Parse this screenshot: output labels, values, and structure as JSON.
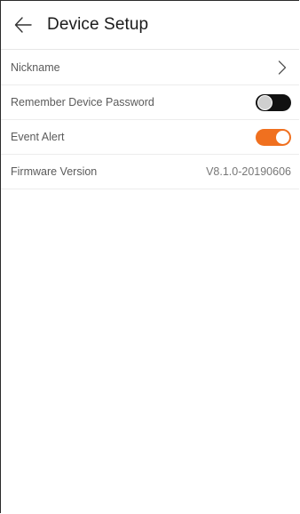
{
  "header": {
    "title": "Device Setup",
    "back_icon": "arrow-left-icon"
  },
  "rows": [
    {
      "label": "Nickname",
      "control": "chevron",
      "icon": "chevron-right-icon"
    },
    {
      "label": "Remember Device Password",
      "control": "toggle",
      "checked": false
    },
    {
      "label": "Event Alert",
      "control": "toggle",
      "checked": true
    },
    {
      "label": "Firmware Version",
      "value": "V8.1.0-20190606"
    }
  ],
  "colors": {
    "accent": "#f0701f",
    "toggle_off": "#111111"
  }
}
